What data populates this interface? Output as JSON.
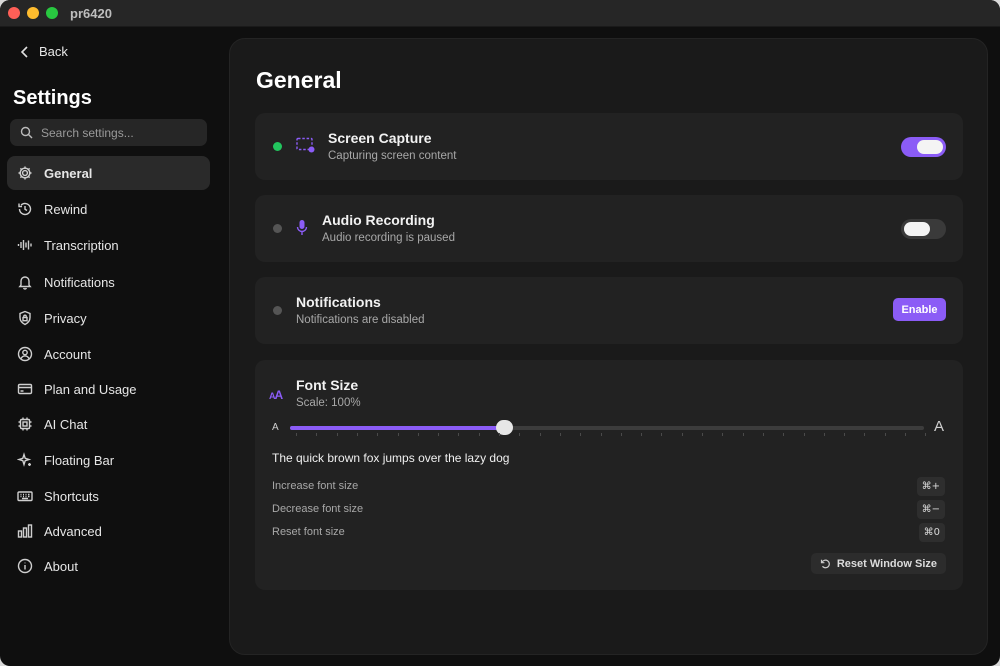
{
  "window": {
    "title": "pr6420"
  },
  "sidebar": {
    "back_label": "Back",
    "title": "Settings",
    "search_placeholder": "Search settings...",
    "items": [
      {
        "label": "General",
        "icon": "gear-icon",
        "active": true
      },
      {
        "label": "Rewind",
        "icon": "history-icon",
        "active": false
      },
      {
        "label": "Transcription",
        "icon": "waveform-icon",
        "active": false
      },
      {
        "label": "Notifications",
        "icon": "bell-icon",
        "active": false
      },
      {
        "label": "Privacy",
        "icon": "shield-lock-icon",
        "active": false
      },
      {
        "label": "Account",
        "icon": "user-circle-icon",
        "active": false
      },
      {
        "label": "Plan and Usage",
        "icon": "credit-card-icon",
        "active": false
      },
      {
        "label": "AI Chat",
        "icon": "chip-icon",
        "active": false
      },
      {
        "label": "Floating Bar",
        "icon": "sparkle-icon",
        "active": false
      },
      {
        "label": "Shortcuts",
        "icon": "keyboard-icon",
        "active": false
      },
      {
        "label": "Advanced",
        "icon": "bar-chart-icon",
        "active": false
      },
      {
        "label": "About",
        "icon": "info-icon",
        "active": false
      }
    ]
  },
  "main": {
    "title": "General",
    "screen_capture": {
      "title": "Screen Capture",
      "subtitle": "Capturing screen content",
      "enabled": true,
      "status_color": "#22c55e"
    },
    "audio_recording": {
      "title": "Audio Recording",
      "subtitle": "Audio recording is paused",
      "enabled": false,
      "status_color": "#555555"
    },
    "notifications": {
      "title": "Notifications",
      "subtitle": "Notifications are disabled",
      "button_label": "Enable",
      "status_color": "#555555"
    },
    "font_size": {
      "title": "Font Size",
      "scale_label": "Scale: 100%",
      "slider_value_fraction": 0.337,
      "min_glyph": "A",
      "max_glyph": "A",
      "sample_text": "The quick brown fox jumps over the lazy dog",
      "shortcuts": [
        {
          "label": "Increase font size",
          "keys": "⌘+"
        },
        {
          "label": "Decrease font size",
          "keys": "⌘−"
        },
        {
          "label": "Reset font size",
          "keys": "⌘0"
        }
      ],
      "reset_button_label": "Reset Window Size"
    }
  },
  "colors": {
    "accent": "#8b5cf6",
    "background": "#0f0f0f",
    "panel": "#1a1a1a",
    "card": "#222222"
  }
}
